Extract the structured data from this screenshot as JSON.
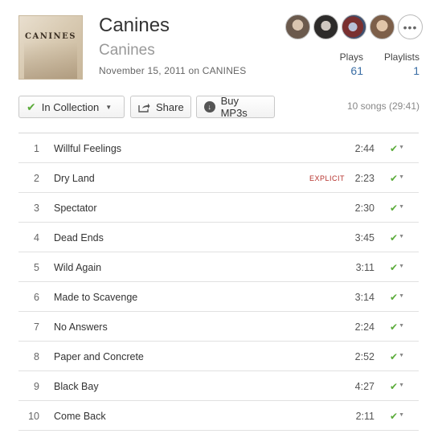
{
  "album": {
    "art_text": "CANINES",
    "title": "Canines",
    "artist": "Canines",
    "release_line": "November 15, 2011 on CANINES"
  },
  "avatars": {
    "more_label": "•••"
  },
  "stats": {
    "plays_label": "Plays",
    "plays_value": "61",
    "playlists_label": "Playlists",
    "playlists_value": "1"
  },
  "toolbar": {
    "collection_label": "In Collection",
    "share_label": "Share",
    "buy_label": "Buy MP3s",
    "song_count": "10 songs (29:41)"
  },
  "icons": {
    "check": "check-icon",
    "share": "share-icon",
    "download": "download-icon",
    "caret": "caret-down-icon"
  },
  "colors": {
    "accent_green": "#5bab3a",
    "link_blue": "#3a6ea5",
    "explicit_red": "#b5302b"
  },
  "tracks": [
    {
      "num": "1",
      "name": "Willful Feelings",
      "explicit": "",
      "duration": "2:44"
    },
    {
      "num": "2",
      "name": "Dry Land",
      "explicit": "EXPLICIT",
      "duration": "2:23"
    },
    {
      "num": "3",
      "name": "Spectator",
      "explicit": "",
      "duration": "2:30"
    },
    {
      "num": "4",
      "name": "Dead Ends",
      "explicit": "",
      "duration": "3:45"
    },
    {
      "num": "5",
      "name": "Wild Again",
      "explicit": "",
      "duration": "3:11"
    },
    {
      "num": "6",
      "name": "Made to Scavenge",
      "explicit": "",
      "duration": "3:14"
    },
    {
      "num": "7",
      "name": "No Answers",
      "explicit": "",
      "duration": "2:24"
    },
    {
      "num": "8",
      "name": "Paper and Concrete",
      "explicit": "",
      "duration": "2:52"
    },
    {
      "num": "9",
      "name": "Black Bay",
      "explicit": "",
      "duration": "4:27"
    },
    {
      "num": "10",
      "name": "Come Back",
      "explicit": "",
      "duration": "2:11"
    }
  ]
}
